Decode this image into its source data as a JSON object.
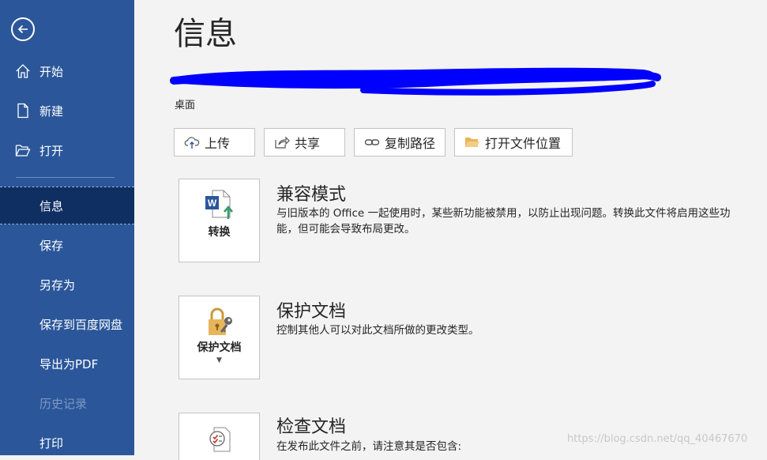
{
  "sidebar": {
    "items": [
      {
        "label": "开始"
      },
      {
        "label": "新建"
      },
      {
        "label": "打开"
      },
      {
        "label": "信息"
      },
      {
        "label": "保存"
      },
      {
        "label": "另存为"
      },
      {
        "label": "保存到百度网盘"
      },
      {
        "label": "导出为PDF"
      },
      {
        "label": "历史记录"
      },
      {
        "label": "打印"
      }
    ]
  },
  "main": {
    "title": "信息",
    "location": "桌面",
    "actions": {
      "upload": "上传",
      "share": "共享",
      "copy_path": "复制路径",
      "open_location": "打开文件位置"
    },
    "sections": [
      {
        "card_label": "转换",
        "title": "兼容模式",
        "description": "与旧版本的 Office 一起使用时，某些新功能被禁用，以防止出现问题。转换此文件将启用这些功能，但可能会导致布局更改。"
      },
      {
        "card_label": "保护文档",
        "title": "保护文档",
        "description": "控制其他人可以对此文档所做的更改类型。"
      },
      {
        "card_label": "",
        "title": "检查文档",
        "description": "在发布此文件之前，请注意其是否包含:"
      }
    ]
  },
  "watermark": "https://blog.csdn.net/qq_40467670",
  "colors": {
    "sidebar": "#2b579a",
    "sidebar_active": "#0f2f63",
    "background": "#f3f3f3",
    "redaction": "#0000ff"
  }
}
